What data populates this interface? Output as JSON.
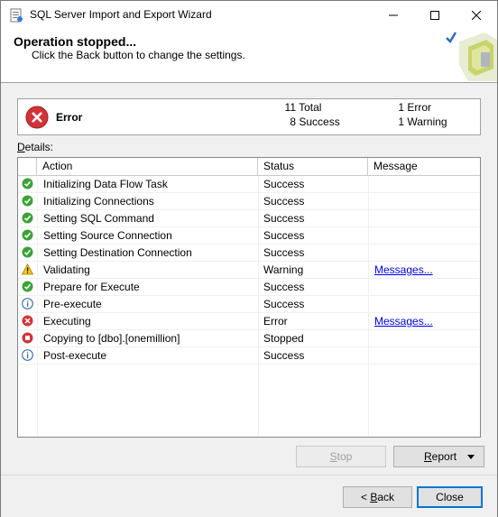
{
  "window": {
    "title": "SQL Server Import and Export Wizard"
  },
  "header": {
    "title": "Operation stopped...",
    "subtitle": "Click the Back button to change the settings."
  },
  "summary": {
    "state": "Error",
    "total_count": "11",
    "total_label": "Total",
    "success_count": "8",
    "success_label": "Success",
    "error_count": "1",
    "error_label": "Error",
    "warning_count": "1",
    "warning_label": "Warning"
  },
  "details": {
    "label_prefix": "D",
    "label_rest": "etails:",
    "columns": [
      "Action",
      "Status",
      "Message"
    ],
    "rows": [
      {
        "icon": "success-icon",
        "action": "Initializing Data Flow Task",
        "status": "Success",
        "message": ""
      },
      {
        "icon": "success-icon",
        "action": "Initializing Connections",
        "status": "Success",
        "message": ""
      },
      {
        "icon": "success-icon",
        "action": "Setting SQL Command",
        "status": "Success",
        "message": ""
      },
      {
        "icon": "success-icon",
        "action": "Setting Source Connection",
        "status": "Success",
        "message": ""
      },
      {
        "icon": "success-icon",
        "action": "Setting Destination Connection",
        "status": "Success",
        "message": ""
      },
      {
        "icon": "warning-icon",
        "action": "Validating",
        "status": "Warning",
        "message": "Messages..."
      },
      {
        "icon": "success-icon",
        "action": "Prepare for Execute",
        "status": "Success",
        "message": ""
      },
      {
        "icon": "info-icon",
        "action": "Pre-execute",
        "status": "Success",
        "message": ""
      },
      {
        "icon": "error-icon",
        "action": "Executing",
        "status": "Error",
        "message": "Messages..."
      },
      {
        "icon": "stopped-icon",
        "action": "Copying to [dbo].[onemillion]",
        "status": "Stopped",
        "message": ""
      },
      {
        "icon": "info-icon",
        "action": "Post-execute",
        "status": "Success",
        "message": ""
      }
    ]
  },
  "buttons": {
    "stop_prefix": "S",
    "stop_rest": "top",
    "report_prefix": "R",
    "report_rest": "eport",
    "back_pre": "< ",
    "back_prefix": "B",
    "back_rest": "ack",
    "close": "Close"
  },
  "colors": {
    "success": "#3aa335",
    "error": "#d13438",
    "warning": "#f2c811",
    "info": "#1f5aa8",
    "link": "#0000ee",
    "focus": "#0078d7"
  }
}
